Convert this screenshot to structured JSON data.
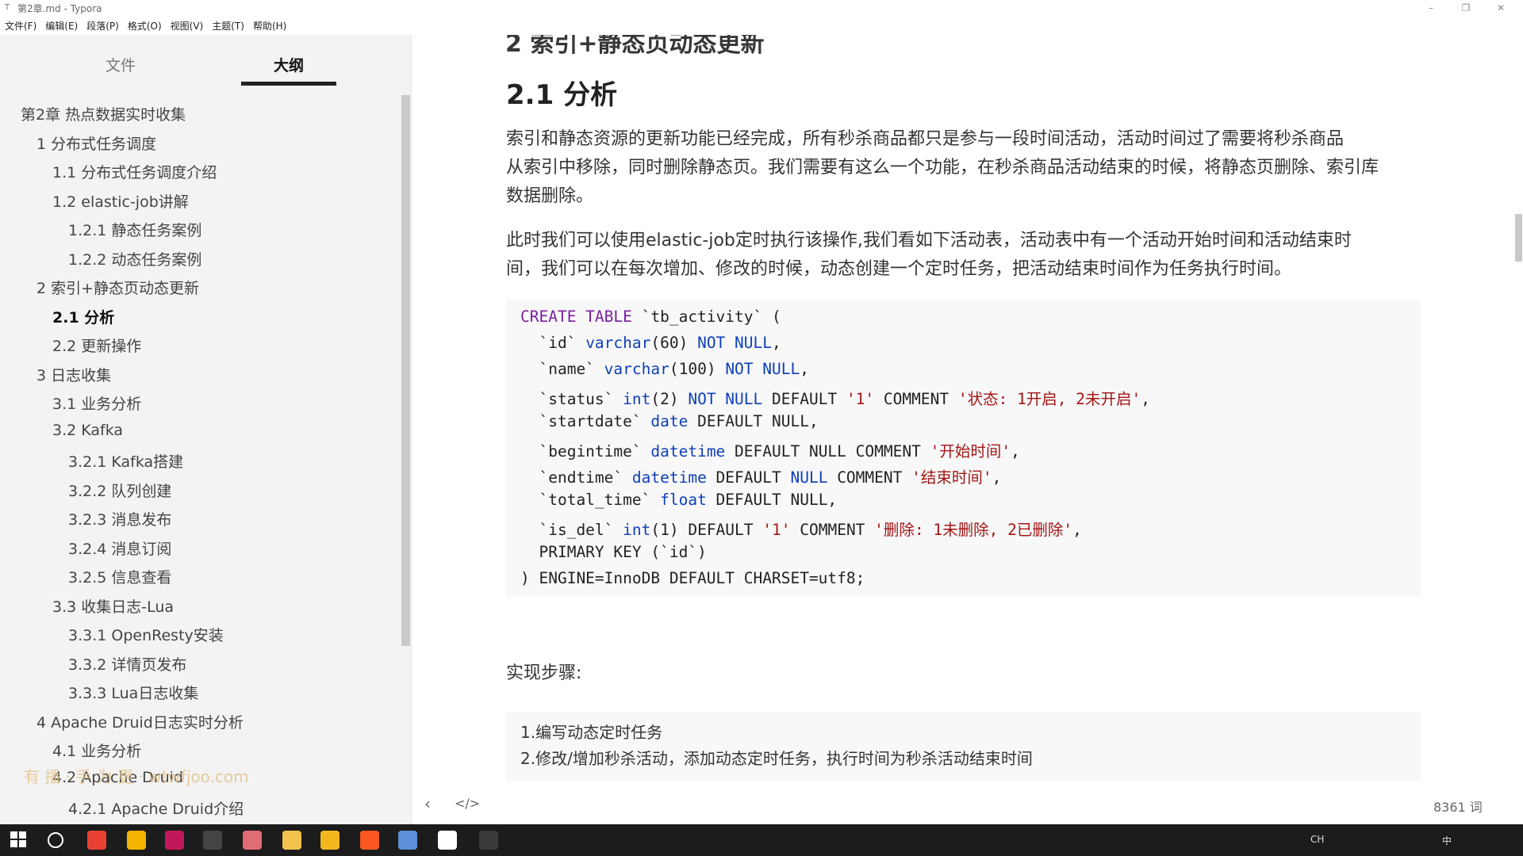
{
  "window": {
    "title": "第2章.md - Typora",
    "app_icon": "typora-icon"
  },
  "window_controls": {
    "minimize": "–",
    "restore": "❐",
    "close": "✕"
  },
  "menubar": [
    "文件(F)",
    "编辑(E)",
    "段落(P)",
    "格式(O)",
    "视图(V)",
    "主题(T)",
    "帮助(H)"
  ],
  "sidebar": {
    "tabs": {
      "file": "文件",
      "outline": "大纲"
    },
    "outline": [
      {
        "label": "第2章 热点数据实时收集",
        "level": 1
      },
      {
        "label": "1 分布式任务调度",
        "level": 2
      },
      {
        "label": "1.1 分布式任务调度介绍",
        "level": 3
      },
      {
        "label": "1.2 elastic-job讲解",
        "level": 3
      },
      {
        "label": "1.2.1 静态任务案例",
        "level": 4
      },
      {
        "label": "1.2.2 动态任务案例",
        "level": 4
      },
      {
        "label": "2 索引+静态页动态更新",
        "level": 2
      },
      {
        "label": "2.1 分析",
        "level": 3,
        "active": true
      },
      {
        "label": "2.2 更新操作",
        "level": 3
      },
      {
        "label": "3 日志收集",
        "level": 2
      },
      {
        "label": "3.1 业务分析",
        "level": 3
      },
      {
        "label": "3.2 Kafka",
        "level": 3
      },
      {
        "label": "3.2.1 Kafka搭建",
        "level": 4
      },
      {
        "label": "3.2.2 队列创建",
        "level": 4
      },
      {
        "label": "3.2.3 消息发布",
        "level": 4
      },
      {
        "label": "3.2.4 消息订阅",
        "level": 4
      },
      {
        "label": "3.2.5 信息查看",
        "level": 4
      },
      {
        "label": "3.3 收集日志-Lua",
        "level": 3
      },
      {
        "label": "3.3.1 OpenResty安装",
        "level": 4
      },
      {
        "label": "3.3.2 详情页发布",
        "level": 4
      },
      {
        "label": "3.3.3 Lua日志收集",
        "level": 4
      },
      {
        "label": "4 Apache Druid日志实时分析",
        "level": 2
      },
      {
        "label": "4.1 业务分析",
        "level": 3
      },
      {
        "label": "4.2 Apache Druid",
        "level": 3
      },
      {
        "label": "4.2.1 Apache Druid介绍",
        "level": 4
      }
    ]
  },
  "watermark": "有 播 · 手 为 更 · wtwfjoo.com",
  "document": {
    "top_heading_partial": "2 索引+静态页动态更新",
    "heading": "2.1 分析",
    "para1": [
      "索引和静态资源的更新功能已经完成，所有秒杀商品都只是参与一段时间活动，活动时间过了需要将秒杀商品",
      "从索引中移除，同时删除静态页。我们需要有这么一个功能，在秒杀商品活动结束的时候，将静态页删除、索引库",
      "数据删除。"
    ],
    "para2": [
      "此时我们可以使用elastic-job定时执行该操作,我们看如下活动表，活动表中有一个活动开始时间和活动结束时",
      "间，我们可以在每次增加、修改的时候，动态创建一个定时任务，把活动结束时间作为任务执行时间。"
    ],
    "code_lines": [
      [
        [
          "kw",
          "CREATE TABLE"
        ],
        [
          "p",
          " `tb_activity` ("
        ]
      ],
      [
        [
          "p",
          "  `id` "
        ],
        [
          "ty",
          "varchar"
        ],
        [
          "p",
          "(60) "
        ],
        [
          "nul",
          "NOT NULL"
        ],
        [
          "p",
          ","
        ]
      ],
      [
        [
          "p",
          "  `name` "
        ],
        [
          "ty",
          "varchar"
        ],
        [
          "p",
          "(100) "
        ],
        [
          "nul",
          "NOT NULL"
        ],
        [
          "p",
          ","
        ]
      ],
      [
        [
          "p",
          "  `status` "
        ],
        [
          "ty",
          "int"
        ],
        [
          "p",
          "(2) "
        ],
        [
          "nul",
          "NOT NULL"
        ],
        [
          "p",
          " DEFAULT "
        ],
        [
          "str",
          "'1'"
        ],
        [
          "p",
          " COMMENT "
        ],
        [
          "str",
          "'状态: 1开启, 2未开启'"
        ],
        [
          "p",
          ","
        ]
      ],
      [
        [
          "p",
          "  `startdate` "
        ],
        [
          "ty",
          "date"
        ],
        [
          "p",
          " DEFAULT NULL,"
        ]
      ],
      [
        [
          "p",
          "  `begintime` "
        ],
        [
          "ty",
          "datetime"
        ],
        [
          "p",
          " DEFAULT NULL COMMENT "
        ],
        [
          "str",
          "'开始时间'"
        ],
        [
          "p",
          ","
        ]
      ],
      [
        [
          "p",
          "  `endtime` "
        ],
        [
          "ty",
          "datetime"
        ],
        [
          "p",
          " DEFAULT "
        ],
        [
          "nul",
          "NULL"
        ],
        [
          "p",
          " COMMENT "
        ],
        [
          "str",
          "'结束时间'"
        ],
        [
          "p",
          ","
        ]
      ],
      [
        [
          "p",
          "  `total_time` "
        ],
        [
          "ty",
          "float"
        ],
        [
          "p",
          " DEFAULT NULL,"
        ]
      ],
      [
        [
          "p",
          "  `is_del` "
        ],
        [
          "ty",
          "int"
        ],
        [
          "p",
          "(1) DEFAULT "
        ],
        [
          "str",
          "'1'"
        ],
        [
          "p",
          " COMMENT "
        ],
        [
          "str",
          "'删除: 1未删除, 2已删除'"
        ],
        [
          "p",
          ","
        ]
      ],
      [
        [
          "p",
          "  PRIMARY KEY (`id`)"
        ]
      ],
      [
        [
          "p",
          ") ENGINE=InnoDB DEFAULT CHARSET=utf8;"
        ]
      ]
    ],
    "steps_label": "实现步骤:",
    "steps": [
      "1.编写动态定时任务",
      "2.修改/增加秒杀活动，添加动态定时任务，执行时间为秒杀活动结束时间"
    ]
  },
  "footer": {
    "back_icon": "‹",
    "source_icon": "</>",
    "word_count": "8361 词"
  },
  "taskbar": {
    "icons": [
      "windows-start-icon",
      "cortana-icon",
      "chrome-icon",
      "app-icon-2",
      "intellij-icon",
      "terminal-icon",
      "app-icon-5",
      "file-explorer-icon",
      "app-icon-7",
      "app-icon-8",
      "app-icon-9",
      "typora-taskbar-icon",
      "app-icon-11"
    ],
    "tray": {
      "lang": "CH",
      "ime": "中"
    }
  }
}
